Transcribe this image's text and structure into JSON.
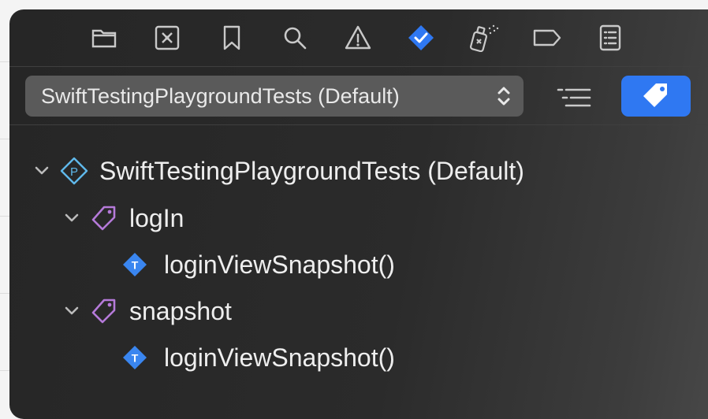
{
  "toolbar": {
    "icons": [
      "folder-icon",
      "source-control-icon",
      "bookmark-icon",
      "search-icon",
      "warning-icon",
      "test-navigator-icon",
      "debug-spray-icon",
      "tag-outline-icon",
      "report-icon"
    ],
    "active": "test-navigator-icon"
  },
  "scheme_selector": {
    "value": "SwiftTestingPlaygroundTests (Default)"
  },
  "tree": {
    "root": {
      "label": "SwiftTestingPlaygroundTests (Default)"
    },
    "groups": [
      {
        "label": "logIn",
        "tests": [
          {
            "label": "loginViewSnapshot()"
          }
        ]
      },
      {
        "label": "snapshot",
        "tests": [
          {
            "label": "loginViewSnapshot()"
          }
        ]
      }
    ]
  },
  "colors": {
    "accent": "#2f78f2",
    "tag_purple": "#b57ad9",
    "test_blue": "#3a86f0",
    "panel": "#2a2a2a",
    "text": "#eeeeee"
  }
}
